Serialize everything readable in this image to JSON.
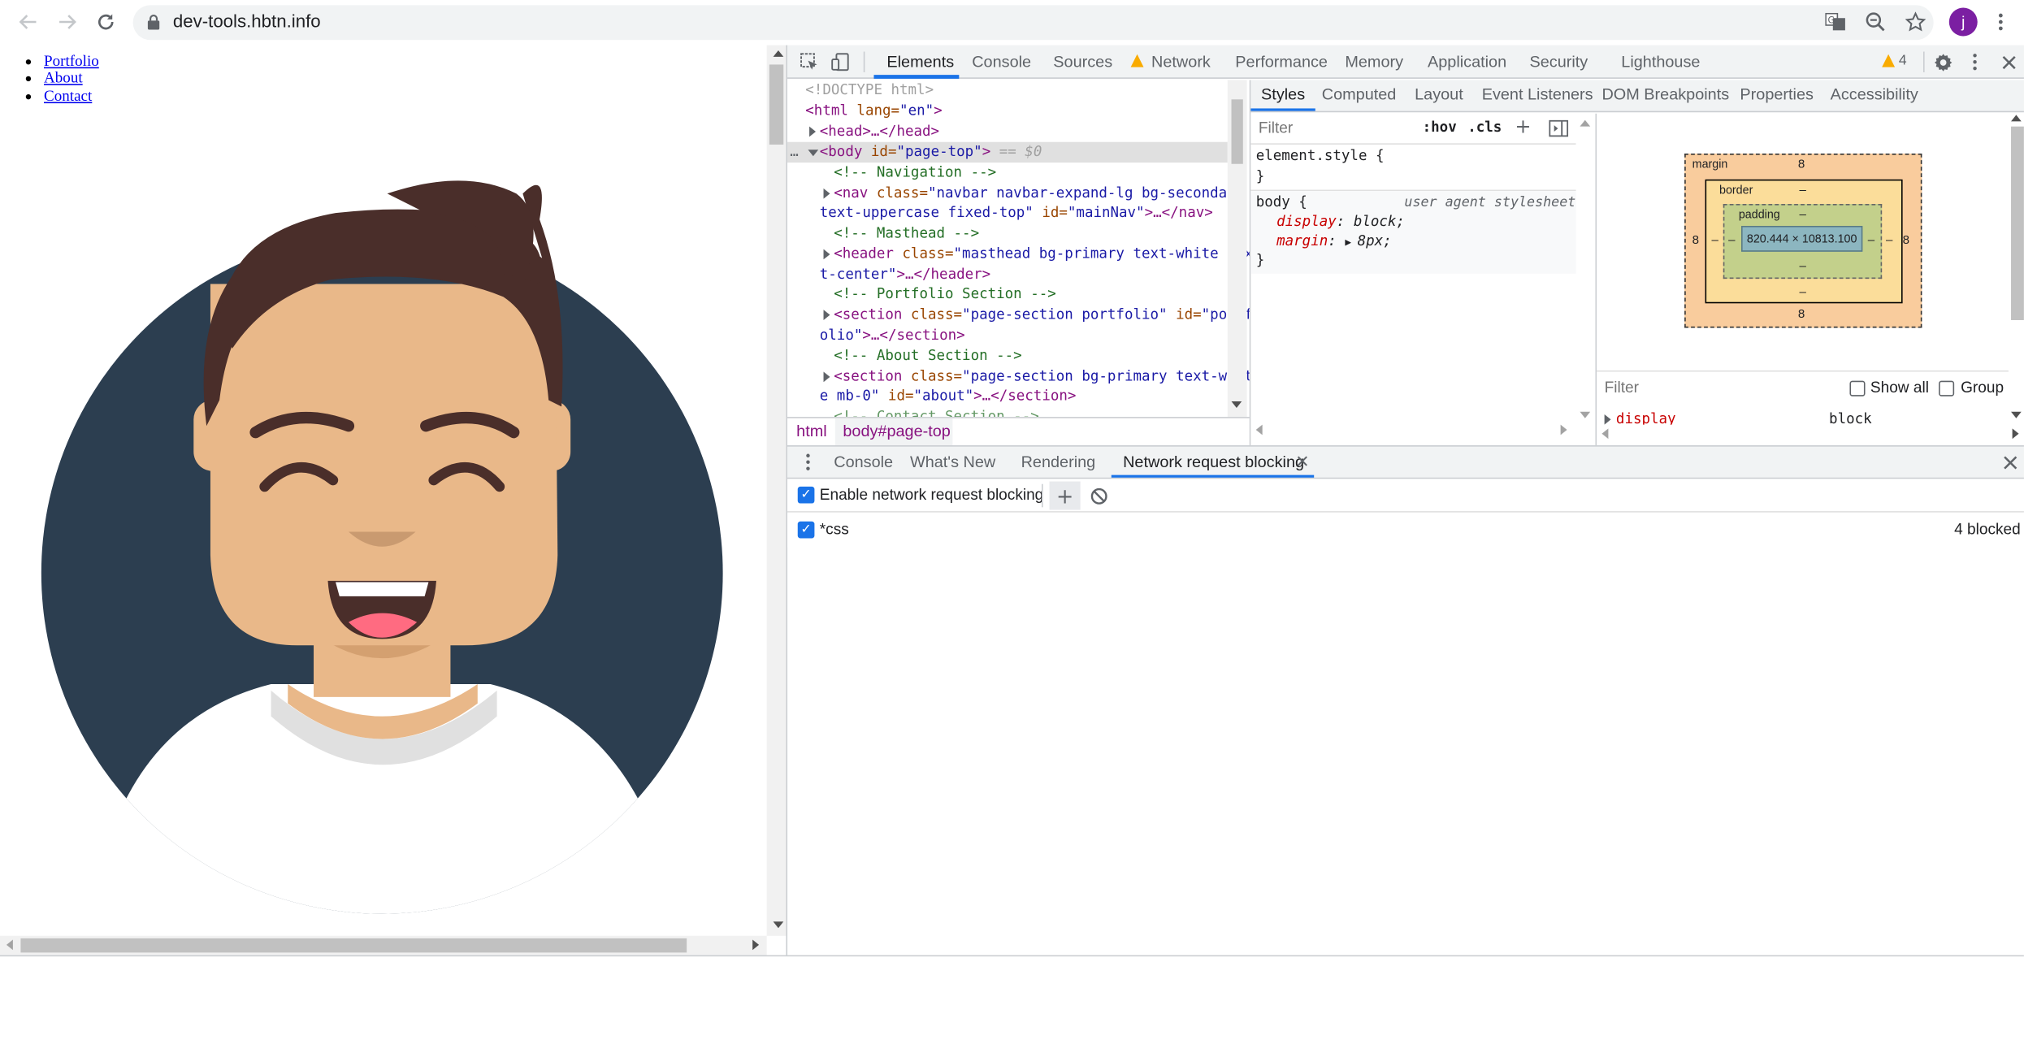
{
  "browser": {
    "url": "dev-tools.hbtn.info",
    "avatar_letter": "j"
  },
  "page": {
    "nav_links": [
      "Portfolio",
      "About",
      "Contact"
    ]
  },
  "devtools": {
    "main_tabs": [
      "Elements",
      "Console",
      "Sources",
      "Network",
      "Performance",
      "Memory",
      "Application",
      "Security",
      "Lighthouse"
    ],
    "warning_count": "4",
    "elements_tree": {
      "doctype": "<!DOCTYPE html>",
      "html_open_tag": "<html",
      "html_attr": " lang=",
      "html_attr_val": "\"en\"",
      "html_close": ">",
      "head": "<head>…</head>",
      "body_tag": "<body",
      "body_attr": " id=",
      "body_attr_val": "\"page-top\"",
      "body_close": ">",
      "body_sel": " == $0",
      "c_nav": "<!-- Navigation -->",
      "nav_1": "<nav",
      "nav_2": " class=",
      "nav_3": "\"navbar navbar-expand-lg bg-secondary",
      "nav_4": "text-uppercase fixed-top\"",
      "nav_5": " id=",
      "nav_6": "\"mainNav\"",
      "nav_7": ">…</nav>",
      "c_masthead": "<!-- Masthead -->",
      "hd_1": "<header",
      "hd_2": " class=",
      "hd_3": "\"masthead bg-primary text-white tex",
      "hd_4": "t-center\"",
      "hd_5": ">…</header>",
      "c_portfolio": "<!-- Portfolio Section -->",
      "ps_1": "<section",
      "ps_2": " class=",
      "ps_3": "\"page-section portfolio\"",
      "ps_4": " id=",
      "ps_5": "\"portf",
      "ps_6": "olio\"",
      "ps_7": ">…</section>",
      "c_about": "<!-- About Section -->",
      "as_1": "<section",
      "as_2": " class=",
      "as_3": "\"page-section bg-primary text-whit",
      "as_4": "e mb-0\"",
      "as_5": " id=",
      "as_6": "\"about\"",
      "as_7": ">…</section>",
      "c_contact": "<!-- Contact Section -->"
    },
    "breadcrumb": [
      "html",
      "body#page-top"
    ],
    "styles_tabs": [
      "Styles",
      "Computed",
      "Layout",
      "Event Listeners",
      "DOM Breakpoints",
      "Properties",
      "Accessibility"
    ],
    "styles": {
      "filter_placeholder": "Filter",
      "hov": ":hov",
      "cls": ".cls",
      "element_style": "element.style {",
      "close_brace": "}",
      "body_selector": "body {",
      "ua_label": "user agent stylesheet",
      "prop1_name": "display",
      "prop1_val": "block;",
      "prop2_name": "margin",
      "prop2_val": "8px;"
    },
    "box_model": {
      "margin_label": "margin",
      "border_label": "border",
      "padding_label": "padding",
      "margin_top": "8",
      "margin_bottom": "8",
      "margin_left": "8",
      "margin_right": "8",
      "border_value": "–",
      "padding_value": "–",
      "content_size": "820.444 × 10813.100"
    },
    "computed": {
      "filter_placeholder": "Filter",
      "show_all": "Show all",
      "group": "Group",
      "prop_name": "display",
      "prop_val": "block"
    },
    "drawer_tabs": [
      "Console",
      "What's New",
      "Rendering",
      "Network request blocking"
    ],
    "blocking": {
      "enable_label": "Enable network request blocking",
      "pattern": "*css",
      "blocked_count": "4 blocked"
    }
  },
  "colors": {
    "accent": "#1a73e8",
    "avatar_bg": "#2c3e50",
    "skin": "#e9b889",
    "hair": "#4a2e2a",
    "profile_purple": "#7b1fa2"
  }
}
